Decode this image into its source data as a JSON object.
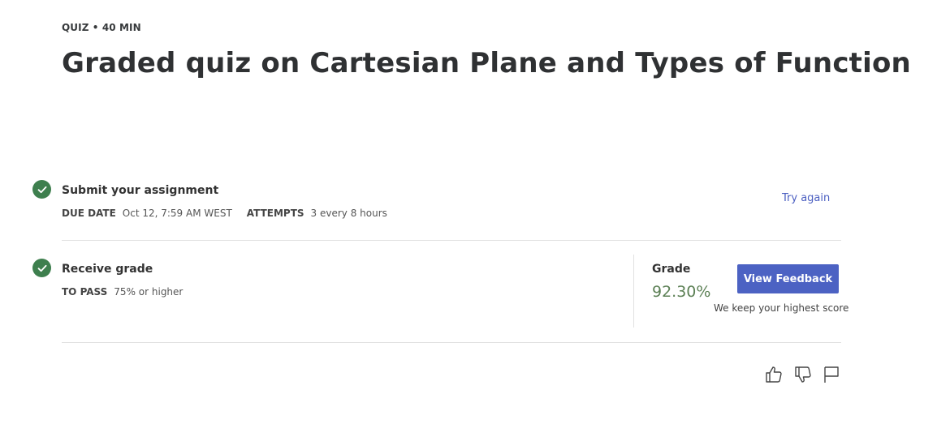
{
  "header": {
    "meta": "QUIZ • 40 MIN",
    "title": "Graded quiz on Cartesian Plane and Types of Function"
  },
  "submit_step": {
    "title": "Submit your assignment",
    "due_date_label": "DUE DATE",
    "due_date_value": "Oct 12, 7:59 AM WEST",
    "attempts_label": "ATTEMPTS",
    "attempts_value": "3 every 8 hours",
    "action_label": "Try again",
    "status_icon": "check-circle-icon"
  },
  "grade_step": {
    "title": "Receive grade",
    "to_pass_label": "TO PASS",
    "to_pass_value": "75% or higher",
    "grade_label": "Grade",
    "grade_value": "92.30%",
    "feedback_button": "View Feedback",
    "note": "We keep your highest score",
    "status_icon": "check-circle-icon"
  },
  "footer_icons": [
    "thumbs-up-icon",
    "thumbs-down-icon",
    "flag-icon"
  ],
  "colors": {
    "accent": "#4c62c3",
    "success": "#3e7f4e",
    "grade": "#5c8055"
  }
}
